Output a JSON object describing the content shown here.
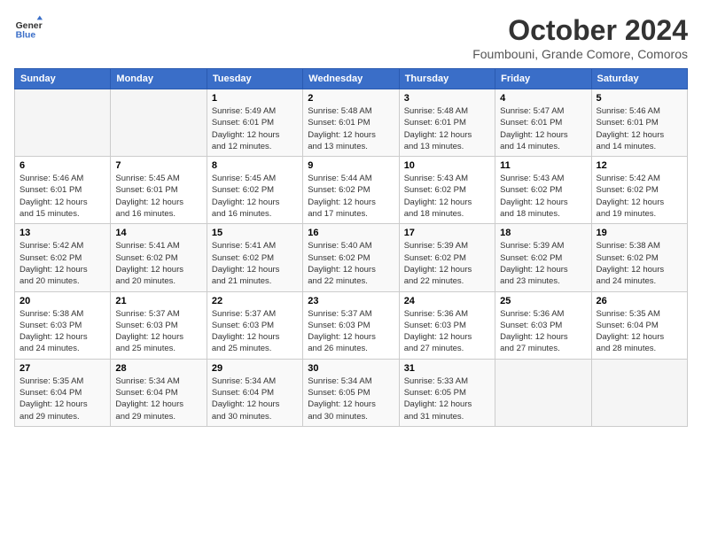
{
  "logo": {
    "line1": "General",
    "line2": "Blue"
  },
  "title": "October 2024",
  "location": "Foumbouni, Grande Comore, Comoros",
  "days_of_week": [
    "Sunday",
    "Monday",
    "Tuesday",
    "Wednesday",
    "Thursday",
    "Friday",
    "Saturday"
  ],
  "weeks": [
    [
      {
        "day": "",
        "detail": ""
      },
      {
        "day": "",
        "detail": ""
      },
      {
        "day": "1",
        "detail": "Sunrise: 5:49 AM\nSunset: 6:01 PM\nDaylight: 12 hours\nand 12 minutes."
      },
      {
        "day": "2",
        "detail": "Sunrise: 5:48 AM\nSunset: 6:01 PM\nDaylight: 12 hours\nand 13 minutes."
      },
      {
        "day": "3",
        "detail": "Sunrise: 5:48 AM\nSunset: 6:01 PM\nDaylight: 12 hours\nand 13 minutes."
      },
      {
        "day": "4",
        "detail": "Sunrise: 5:47 AM\nSunset: 6:01 PM\nDaylight: 12 hours\nand 14 minutes."
      },
      {
        "day": "5",
        "detail": "Sunrise: 5:46 AM\nSunset: 6:01 PM\nDaylight: 12 hours\nand 14 minutes."
      }
    ],
    [
      {
        "day": "6",
        "detail": "Sunrise: 5:46 AM\nSunset: 6:01 PM\nDaylight: 12 hours\nand 15 minutes."
      },
      {
        "day": "7",
        "detail": "Sunrise: 5:45 AM\nSunset: 6:01 PM\nDaylight: 12 hours\nand 16 minutes."
      },
      {
        "day": "8",
        "detail": "Sunrise: 5:45 AM\nSunset: 6:02 PM\nDaylight: 12 hours\nand 16 minutes."
      },
      {
        "day": "9",
        "detail": "Sunrise: 5:44 AM\nSunset: 6:02 PM\nDaylight: 12 hours\nand 17 minutes."
      },
      {
        "day": "10",
        "detail": "Sunrise: 5:43 AM\nSunset: 6:02 PM\nDaylight: 12 hours\nand 18 minutes."
      },
      {
        "day": "11",
        "detail": "Sunrise: 5:43 AM\nSunset: 6:02 PM\nDaylight: 12 hours\nand 18 minutes."
      },
      {
        "day": "12",
        "detail": "Sunrise: 5:42 AM\nSunset: 6:02 PM\nDaylight: 12 hours\nand 19 minutes."
      }
    ],
    [
      {
        "day": "13",
        "detail": "Sunrise: 5:42 AM\nSunset: 6:02 PM\nDaylight: 12 hours\nand 20 minutes."
      },
      {
        "day": "14",
        "detail": "Sunrise: 5:41 AM\nSunset: 6:02 PM\nDaylight: 12 hours\nand 20 minutes."
      },
      {
        "day": "15",
        "detail": "Sunrise: 5:41 AM\nSunset: 6:02 PM\nDaylight: 12 hours\nand 21 minutes."
      },
      {
        "day": "16",
        "detail": "Sunrise: 5:40 AM\nSunset: 6:02 PM\nDaylight: 12 hours\nand 22 minutes."
      },
      {
        "day": "17",
        "detail": "Sunrise: 5:39 AM\nSunset: 6:02 PM\nDaylight: 12 hours\nand 22 minutes."
      },
      {
        "day": "18",
        "detail": "Sunrise: 5:39 AM\nSunset: 6:02 PM\nDaylight: 12 hours\nand 23 minutes."
      },
      {
        "day": "19",
        "detail": "Sunrise: 5:38 AM\nSunset: 6:02 PM\nDaylight: 12 hours\nand 24 minutes."
      }
    ],
    [
      {
        "day": "20",
        "detail": "Sunrise: 5:38 AM\nSunset: 6:03 PM\nDaylight: 12 hours\nand 24 minutes."
      },
      {
        "day": "21",
        "detail": "Sunrise: 5:37 AM\nSunset: 6:03 PM\nDaylight: 12 hours\nand 25 minutes."
      },
      {
        "day": "22",
        "detail": "Sunrise: 5:37 AM\nSunset: 6:03 PM\nDaylight: 12 hours\nand 25 minutes."
      },
      {
        "day": "23",
        "detail": "Sunrise: 5:37 AM\nSunset: 6:03 PM\nDaylight: 12 hours\nand 26 minutes."
      },
      {
        "day": "24",
        "detail": "Sunrise: 5:36 AM\nSunset: 6:03 PM\nDaylight: 12 hours\nand 27 minutes."
      },
      {
        "day": "25",
        "detail": "Sunrise: 5:36 AM\nSunset: 6:03 PM\nDaylight: 12 hours\nand 27 minutes."
      },
      {
        "day": "26",
        "detail": "Sunrise: 5:35 AM\nSunset: 6:04 PM\nDaylight: 12 hours\nand 28 minutes."
      }
    ],
    [
      {
        "day": "27",
        "detail": "Sunrise: 5:35 AM\nSunset: 6:04 PM\nDaylight: 12 hours\nand 29 minutes."
      },
      {
        "day": "28",
        "detail": "Sunrise: 5:34 AM\nSunset: 6:04 PM\nDaylight: 12 hours\nand 29 minutes."
      },
      {
        "day": "29",
        "detail": "Sunrise: 5:34 AM\nSunset: 6:04 PM\nDaylight: 12 hours\nand 30 minutes."
      },
      {
        "day": "30",
        "detail": "Sunrise: 5:34 AM\nSunset: 6:05 PM\nDaylight: 12 hours\nand 30 minutes."
      },
      {
        "day": "31",
        "detail": "Sunrise: 5:33 AM\nSunset: 6:05 PM\nDaylight: 12 hours\nand 31 minutes."
      },
      {
        "day": "",
        "detail": ""
      },
      {
        "day": "",
        "detail": ""
      }
    ]
  ]
}
